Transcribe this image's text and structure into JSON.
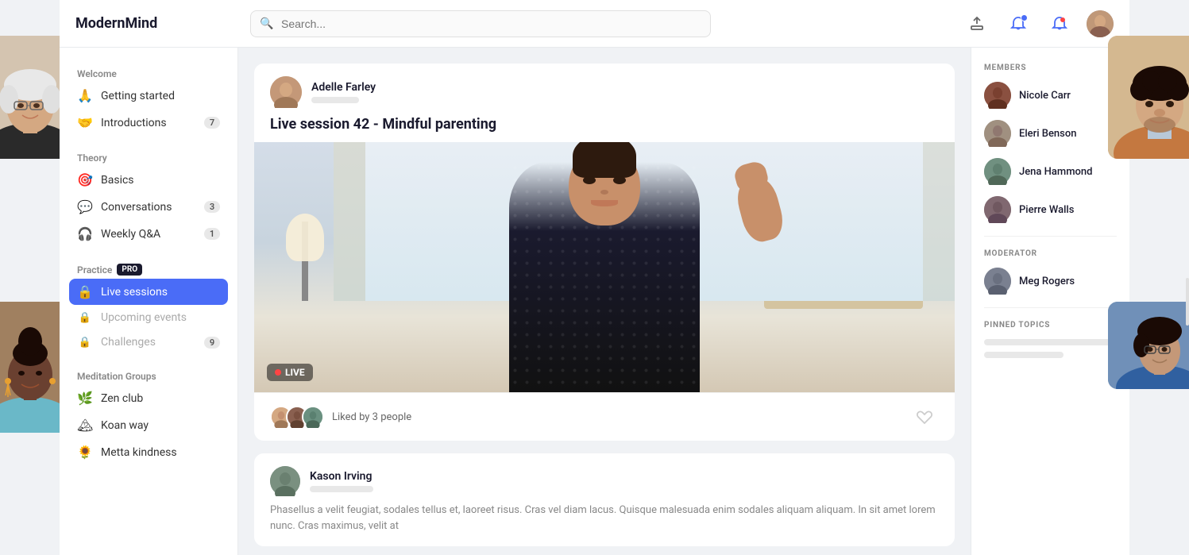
{
  "app": {
    "logo": "ModernMind",
    "search_placeholder": "Search..."
  },
  "header": {
    "icons": {
      "upload": "⬆",
      "bell_dot": "🔔",
      "bell": "🔔",
      "avatar": "👤"
    }
  },
  "sidebar": {
    "sections": [
      {
        "title": "Welcome",
        "items": [
          {
            "icon": "🙏",
            "label": "Getting started",
            "badge": null,
            "locked": false,
            "active": false
          },
          {
            "icon": "🤝",
            "label": "Introductions",
            "badge": "7",
            "locked": false,
            "active": false
          }
        ]
      },
      {
        "title": "Theory",
        "items": [
          {
            "icon": "🎯",
            "label": "Basics",
            "badge": null,
            "locked": false,
            "active": false
          },
          {
            "icon": "💬",
            "label": "Conversations",
            "badge": "3",
            "locked": false,
            "active": false
          },
          {
            "icon": "🎧",
            "label": "Weekly Q&A",
            "badge": "1",
            "locked": false,
            "active": false
          }
        ]
      },
      {
        "title": "Practice",
        "pro": true,
        "items": [
          {
            "icon": "🔒",
            "label": "Live sessions",
            "badge": null,
            "locked": false,
            "active": true
          },
          {
            "icon": "🔒",
            "label": "Upcoming events",
            "badge": null,
            "locked": true,
            "active": false
          },
          {
            "icon": "🔒",
            "label": "Challenges",
            "badge": "9",
            "locked": true,
            "active": false
          }
        ]
      },
      {
        "title": "Meditation Groups",
        "items": [
          {
            "icon": "🌿",
            "label": "Zen club",
            "badge": null,
            "locked": false,
            "active": false
          },
          {
            "icon": "🏔",
            "label": "Koan way",
            "badge": null,
            "locked": false,
            "active": false
          },
          {
            "icon": "🌻",
            "label": "Metta kindness",
            "badge": null,
            "locked": false,
            "active": false
          }
        ]
      }
    ]
  },
  "post": {
    "title": "Live session 42 - Mindful parenting",
    "author": "Adelle Farley",
    "live_label": "LIVE",
    "liked_by": "Liked by 3 people",
    "liked_count": 3
  },
  "comment": {
    "author": "Kason Irving",
    "text": "Phasellus a velit feugiat, sodales tellus et, laoreet risus. Cras vel diam lacus. Quisque malesuada enim sodales aliquam aliquam. In sit amet lorem nunc. Cras maximus, velit at"
  },
  "right_sidebar": {
    "members_label": "MEMBERS",
    "members": [
      {
        "name": "Nicole Carr"
      },
      {
        "name": "Eleri Benson"
      },
      {
        "name": "Jena Hammond"
      },
      {
        "name": "Pierre Walls"
      }
    ],
    "moderator_label": "MODERATOR",
    "moderator": {
      "name": "Meg Rogers"
    },
    "pinned_label": "PINNED TOPICS"
  }
}
